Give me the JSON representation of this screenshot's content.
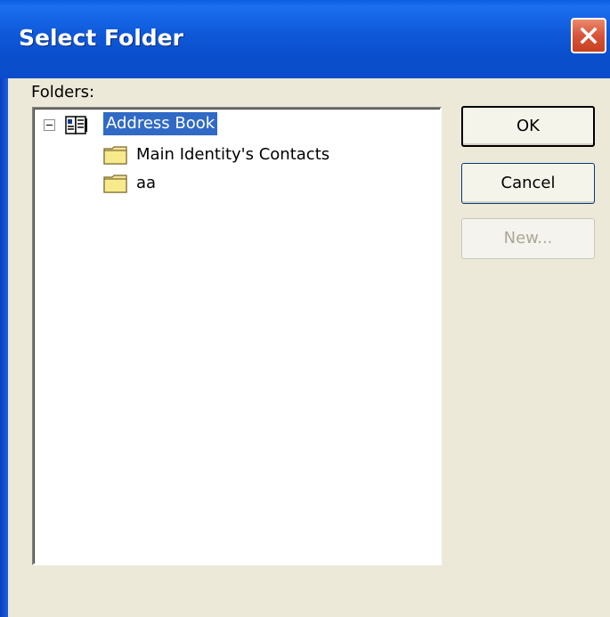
{
  "window": {
    "title": "Select Folder",
    "close_icon": "close-icon"
  },
  "folders_label": "Folders:",
  "tree": {
    "root": {
      "label": "Address Book",
      "icon": "address-book-icon",
      "expanded": true,
      "selected": true
    },
    "children": [
      {
        "label": "Main Identity's Contacts",
        "icon": "folder-icon"
      },
      {
        "label": "aa",
        "icon": "folder-icon"
      }
    ]
  },
  "buttons": {
    "ok": "OK",
    "cancel": "Cancel",
    "new": "New..."
  },
  "colors": {
    "titlebar": "#0a4fcc",
    "selection": "#316ac5",
    "dialog_bg": "#ece9d8"
  }
}
